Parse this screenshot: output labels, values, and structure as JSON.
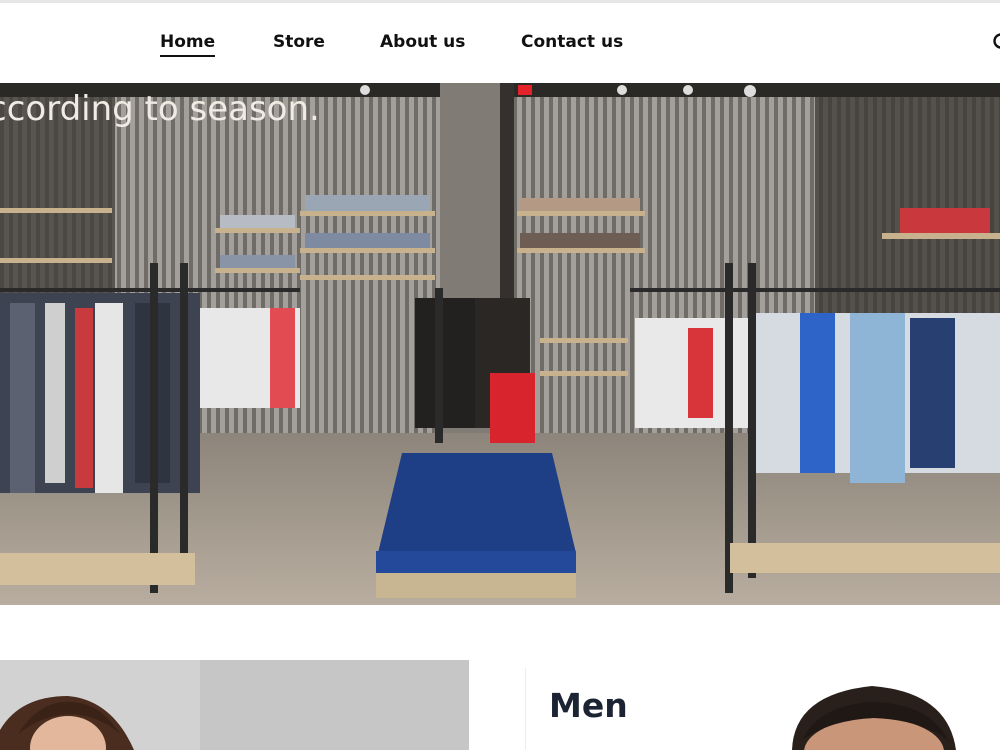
{
  "nav": {
    "items": [
      {
        "label": "Home",
        "active": true
      },
      {
        "label": "Store",
        "active": false
      },
      {
        "label": "About us",
        "active": false
      },
      {
        "label": "Contact us",
        "active": false
      }
    ],
    "search_icon": "search-icon"
  },
  "hero": {
    "title": "ccording to season."
  },
  "categories": {
    "men_title": "Men"
  },
  "colors": {
    "text_dark": "#111111",
    "heading_navy": "#1c2333",
    "accent_red": "#e3222a"
  }
}
